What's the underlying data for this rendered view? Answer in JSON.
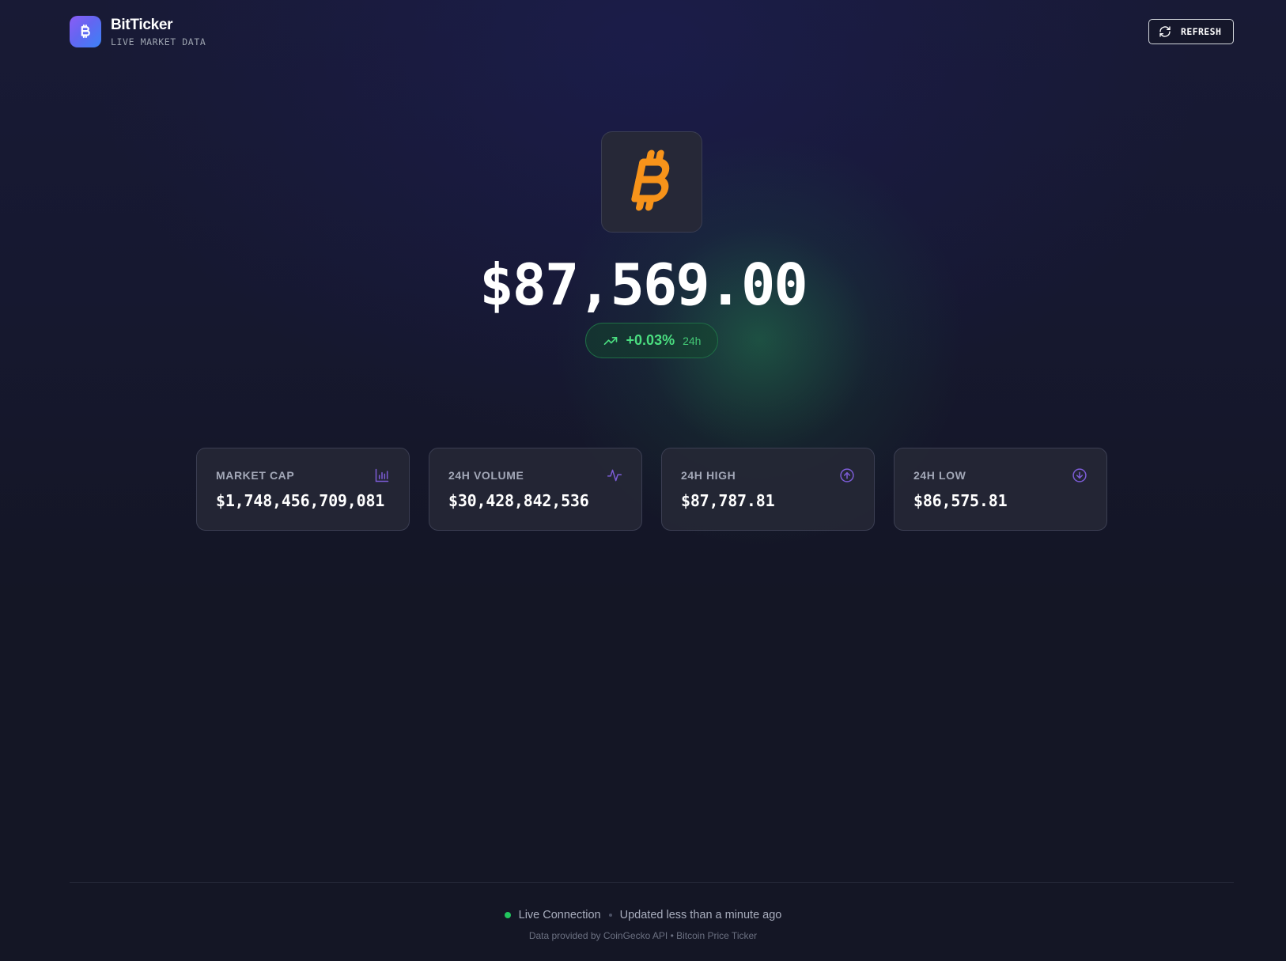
{
  "app": {
    "name": "BitTicker",
    "subtitle": "LIVE MARKET DATA",
    "logo_icon": "bitcoin-icon"
  },
  "header": {
    "refresh_label": "REFRESH",
    "refresh_icon": "refresh-icon"
  },
  "hero": {
    "coin_icon": "bitcoin-icon",
    "coin_color": "#f7931a",
    "price": "$87,569.00",
    "change_pct": "+0.03%",
    "change_period": "24h",
    "change_icon": "trending-up-icon",
    "positive_color": "#4ade80"
  },
  "stats": [
    {
      "label": "MARKET CAP",
      "value": "$1,748,456,709,081",
      "icon": "bar-chart-icon"
    },
    {
      "label": "24H VOLUME",
      "value": "$30,428,842,536",
      "icon": "activity-icon"
    },
    {
      "label": "24H HIGH",
      "value": "$87,787.81",
      "icon": "arrow-up-circle-icon"
    },
    {
      "label": "24H LOW",
      "value": "$86,575.81",
      "icon": "arrow-down-circle-icon"
    }
  ],
  "footer": {
    "connection": "Live Connection",
    "updated": "Updated less than a minute ago",
    "credit": "Data provided by CoinGecko API • Bitcoin Price Ticker"
  },
  "colors": {
    "background": "#141625",
    "accent_purple": "#7c5cd6",
    "live_green": "#22c55e"
  }
}
